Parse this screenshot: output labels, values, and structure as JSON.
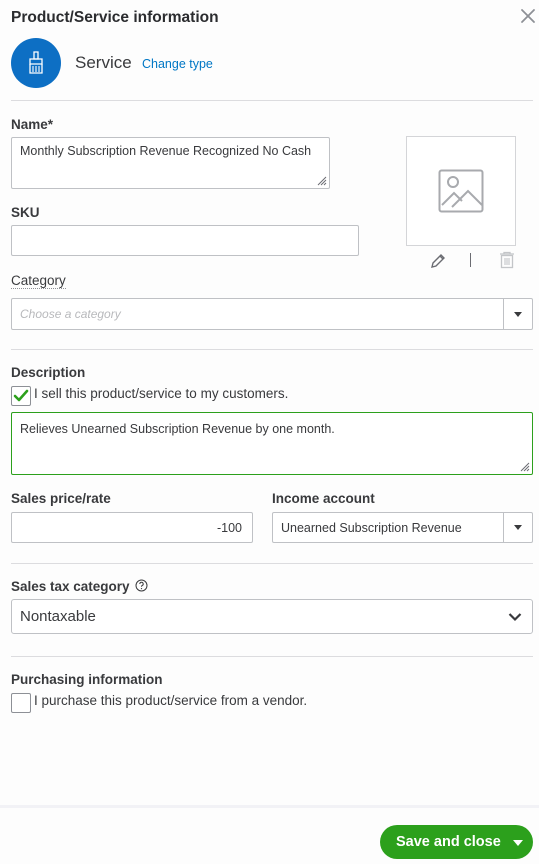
{
  "header": {
    "title": "Product/Service information",
    "close_icon": "close-icon"
  },
  "type": {
    "icon": "paintbrush-icon",
    "label": "Service",
    "change_link": "Change type",
    "accent": "#0d6fc4"
  },
  "name": {
    "label": "Name*",
    "value": "Monthly Subscription Revenue Recognized No Cash"
  },
  "sku": {
    "label": "SKU",
    "value": ""
  },
  "image": {
    "placeholder_icon": "image-placeholder-icon",
    "edit_icon": "pencil-icon",
    "delete_icon": "trash-icon"
  },
  "category": {
    "label": "Category",
    "placeholder": "Choose a category",
    "value": ""
  },
  "description": {
    "label": "Description",
    "sell_checkbox_label": "I sell this product/service to my customers.",
    "sell_checked": true,
    "value": "Relieves Unearned Subscription Revenue by one month.",
    "focus_color": "#2ca01c"
  },
  "sales_price": {
    "label": "Sales price/rate",
    "value": "-100"
  },
  "income_account": {
    "label": "Income account",
    "value": "Unearned Subscription Revenue"
  },
  "sales_tax": {
    "label": "Sales tax category",
    "help_icon": "help-icon",
    "value": "Nontaxable"
  },
  "purchasing": {
    "label": "Purchasing information",
    "checkbox_label": "I purchase this product/service from a vendor.",
    "checked": false
  },
  "footer": {
    "save_label": "Save and close",
    "button_color": "#2ca01c"
  }
}
